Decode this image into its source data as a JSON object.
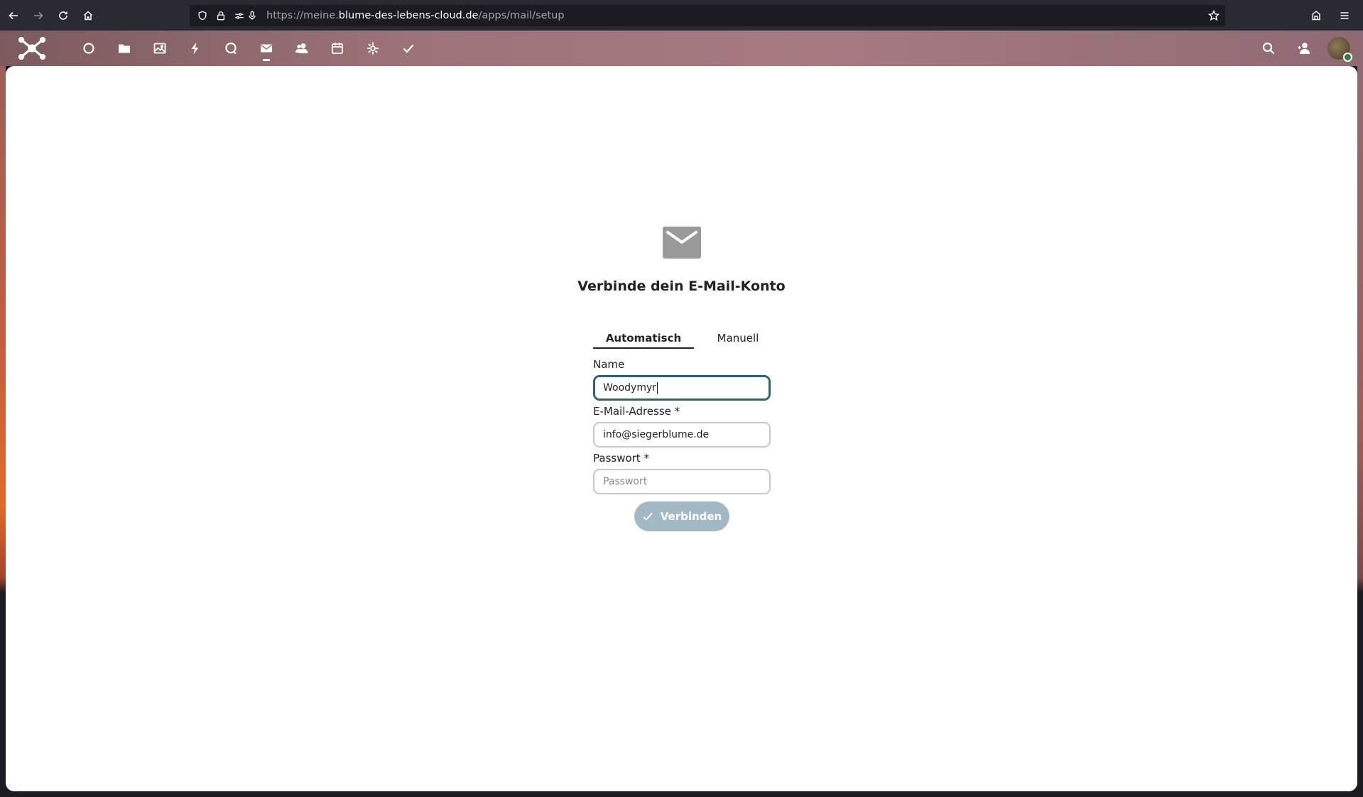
{
  "browser": {
    "url_prefix": "https://meine.",
    "url_host": "blume-des-lebens-cloud.de",
    "url_path": "/apps/mail/setup"
  },
  "header": {
    "logo": "nextcloud-logo-icon",
    "apps": [
      {
        "name": "dashboard-icon",
        "active": false
      },
      {
        "name": "files-icon",
        "active": false
      },
      {
        "name": "photos-icon",
        "active": false
      },
      {
        "name": "activity-icon",
        "active": false
      },
      {
        "name": "talk-icon",
        "active": false
      },
      {
        "name": "mail-icon",
        "active": true
      },
      {
        "name": "contacts-icon",
        "active": false
      },
      {
        "name": "calendar-icon",
        "active": false
      },
      {
        "name": "deck-icon",
        "active": false
      },
      {
        "name": "tasks-icon",
        "active": false
      }
    ]
  },
  "setup": {
    "title": "Verbinde dein E-Mail-Konto",
    "tabs": {
      "automatic": "Automatisch",
      "manual": "Manuell"
    },
    "name_label": "Name",
    "name_value": "Woodymyr",
    "email_label": "E-Mail-Adresse *",
    "email_value": "info@siegerblume.de",
    "password_label": "Passwort *",
    "password_placeholder": "Passwort",
    "connect_label": "Verbinden"
  },
  "colors": {
    "primary_disabled": "#a2b8c4",
    "focus_border": "#2f5e79",
    "status_online": "#2d7b41"
  }
}
